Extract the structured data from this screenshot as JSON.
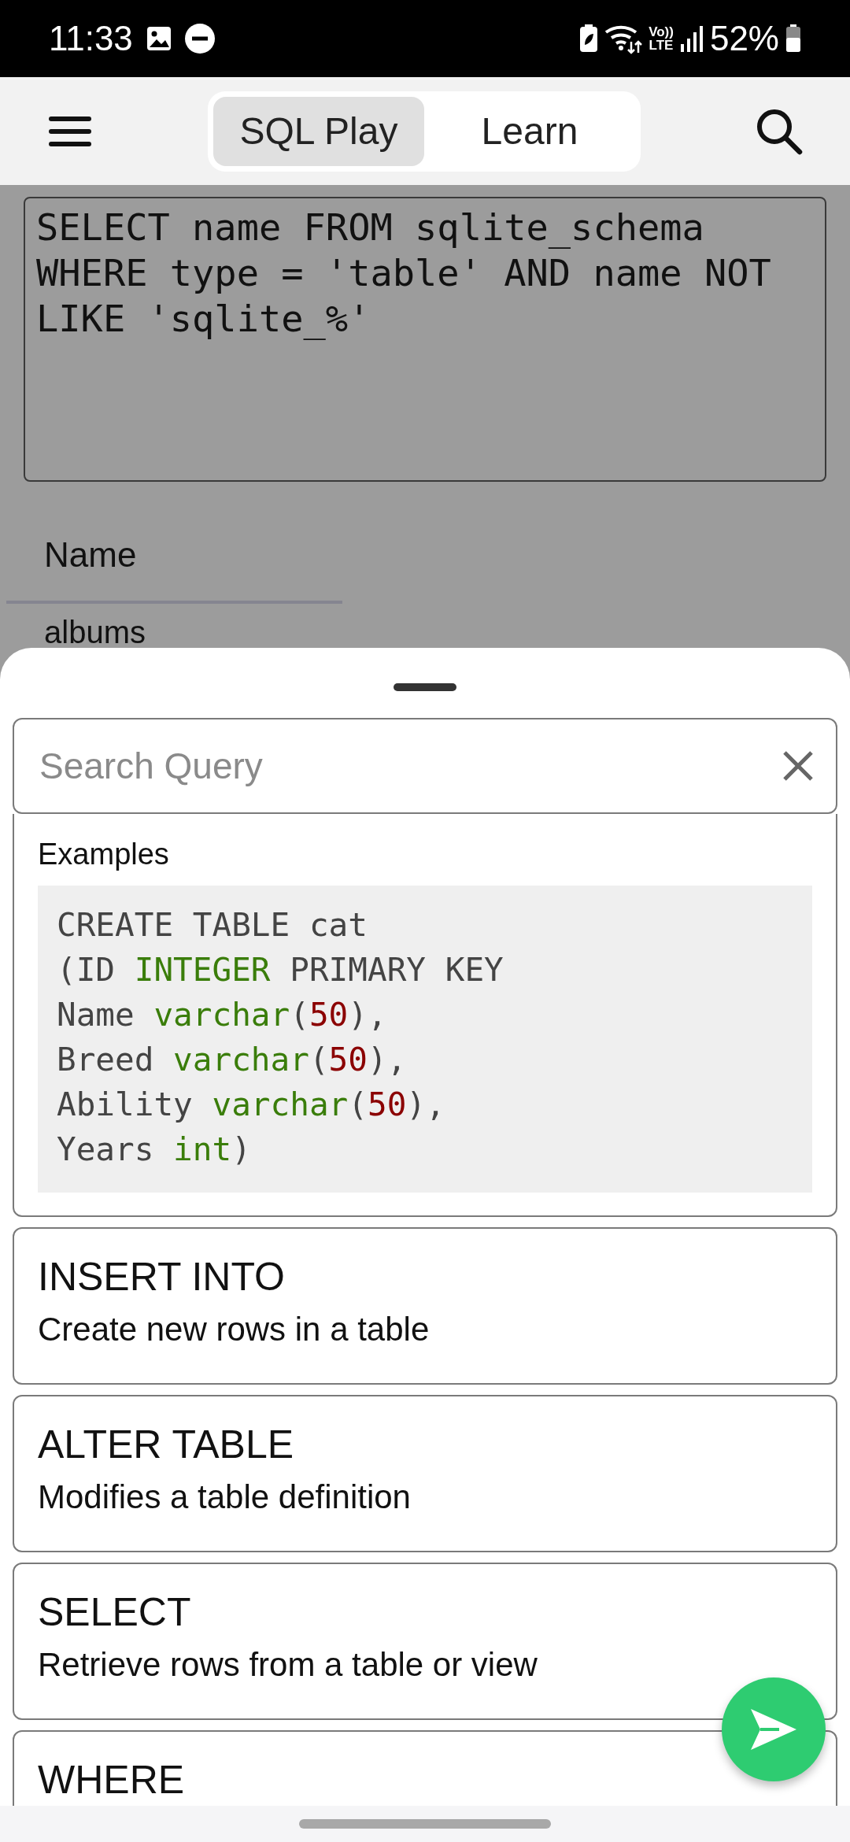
{
  "status_bar": {
    "time": "11:33",
    "volte_label": "Vo))",
    "network_label": "LTE",
    "battery": "52%"
  },
  "top_bar": {
    "tabs": [
      {
        "label": "SQL Play",
        "selected": true
      },
      {
        "label": "Learn",
        "selected": false
      }
    ]
  },
  "query_editor": {
    "value": "SELECT name FROM sqlite_schema WHERE type = 'table' AND name NOT LIKE 'sqlite_%'"
  },
  "results": {
    "columns": [
      "Name"
    ],
    "rows": [
      [
        "albums"
      ]
    ]
  },
  "sheet": {
    "search": {
      "placeholder": "Search Query"
    },
    "examples": {
      "label": "Examples",
      "code_lines": [
        [
          {
            "kind": "plain",
            "text": "CREATE TABLE cat"
          }
        ],
        [
          {
            "kind": "plain",
            "text": "(ID "
          },
          {
            "kind": "type",
            "text": "INTEGER"
          },
          {
            "kind": "plain",
            "text": " PRIMARY KEY"
          }
        ],
        [
          {
            "kind": "plain",
            "text": "Name "
          },
          {
            "kind": "type",
            "text": "varchar"
          },
          {
            "kind": "plain",
            "text": "("
          },
          {
            "kind": "number",
            "text": "50"
          },
          {
            "kind": "plain",
            "text": "),"
          }
        ],
        [
          {
            "kind": "plain",
            "text": "Breed "
          },
          {
            "kind": "type",
            "text": "varchar"
          },
          {
            "kind": "plain",
            "text": "("
          },
          {
            "kind": "number",
            "text": "50"
          },
          {
            "kind": "plain",
            "text": "),"
          }
        ],
        [
          {
            "kind": "plain",
            "text": "Ability "
          },
          {
            "kind": "type",
            "text": "varchar"
          },
          {
            "kind": "plain",
            "text": "("
          },
          {
            "kind": "number",
            "text": "50"
          },
          {
            "kind": "plain",
            "text": "),"
          }
        ],
        [
          {
            "kind": "plain",
            "text": "Years "
          },
          {
            "kind": "type",
            "text": "int"
          },
          {
            "kind": "plain",
            "text": ")"
          }
        ]
      ]
    },
    "commands": [
      {
        "title": "INSERT INTO",
        "description": "Create new rows in a table"
      },
      {
        "title": "ALTER TABLE",
        "description": "Modifies a table definition"
      },
      {
        "title": "SELECT",
        "description": "Retrieve rows from a table or view"
      },
      {
        "title": "WHERE"
      }
    ]
  }
}
